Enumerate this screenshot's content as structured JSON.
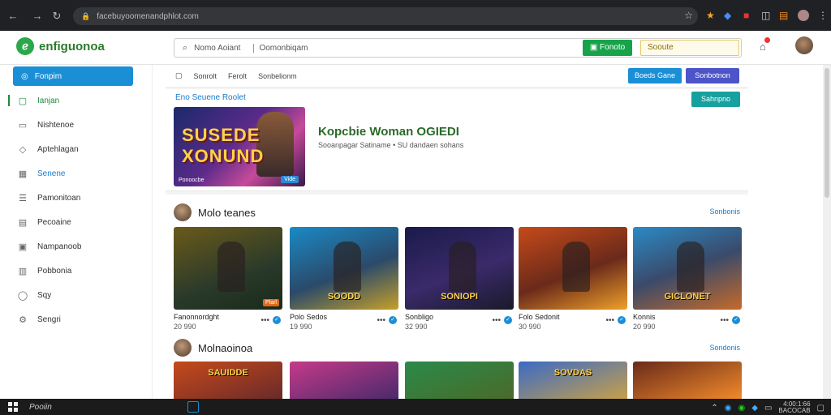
{
  "browser": {
    "url": "facebuyoomenandphlot.com",
    "back_icon": "arrow-left-icon",
    "forward_icon": "arrow-right-icon",
    "reload_icon": "reload-icon"
  },
  "header": {
    "logo_name": "enfiguonoa",
    "search_query": "Nomo Aoiant",
    "search_hint": "Oomonbiqam",
    "search_button": "Fonoto",
    "secondary_field": "Sooute"
  },
  "sidebar": {
    "active_item": "Fonpim",
    "items": [
      {
        "label": "Ianjan",
        "icon": "play-icon"
      },
      {
        "label": "Nishtenoe",
        "icon": "book-icon"
      },
      {
        "label": "Aptehlagan",
        "icon": "tag-icon"
      },
      {
        "label": "Senene",
        "icon": "grid-icon"
      },
      {
        "label": "Pamonitoan",
        "icon": "list-icon"
      },
      {
        "label": "Pecoaine",
        "icon": "doc-icon"
      },
      {
        "label": "Nampanoob",
        "icon": "box-icon"
      },
      {
        "label": "Pobbonia",
        "icon": "folder-icon"
      },
      {
        "label": "Sqy",
        "icon": "circle-icon"
      },
      {
        "label": "Sengri",
        "icon": "gear-icon"
      }
    ]
  },
  "toolbar": {
    "items": [
      "Sonrolt",
      "Ferolt",
      "Sonbelionm"
    ],
    "button1": "Boeds Gane",
    "button2": "Sonbotnon"
  },
  "featured": {
    "label": "Eno Seuene Roolet",
    "button": "Sahnpno",
    "image_title": "SUSEDE XONUND",
    "image_caption": "Ponoocbe",
    "image_badge": "Vide",
    "title": "Kopcbie Woman OGIEDI",
    "subtitle": "Sooanpagar Satiname • SU dandaen sohans"
  },
  "section1": {
    "title": "Molo teanes",
    "see_all": "Sonbonis",
    "cards": [
      {
        "title": "Fanonnordght",
        "meta": "20 990",
        "label": "",
        "tag": "Plarl"
      },
      {
        "title": "Polo Sedos",
        "meta": "19 990",
        "label": "SOODD",
        "tag": ""
      },
      {
        "title": "Sonbligo",
        "meta": "32 990",
        "label": "SONIOPI",
        "tag": ""
      },
      {
        "title": "Folo Sedonit",
        "meta": "30 990",
        "label": "",
        "tag": ""
      },
      {
        "title": "Konnis",
        "meta": "20 990",
        "label": "GICLONET",
        "tag": ""
      }
    ]
  },
  "section2": {
    "title": "Molnaoinoa",
    "see_all": "Sondonis",
    "cards": [
      {
        "label": "SAUIDDE"
      },
      {
        "label": ""
      },
      {
        "label": ""
      },
      {
        "label": "SOVDAS"
      },
      {
        "label": ""
      }
    ]
  },
  "taskbar": {
    "search": "Pooiin",
    "clock": "4:00:1:66",
    "date": "BACOCAB"
  },
  "colors": {
    "accent_blue": "#1a8fd6",
    "accent_green": "#17a34a",
    "accent_indigo": "#4c54c8",
    "accent_teal": "#17a0a0"
  }
}
